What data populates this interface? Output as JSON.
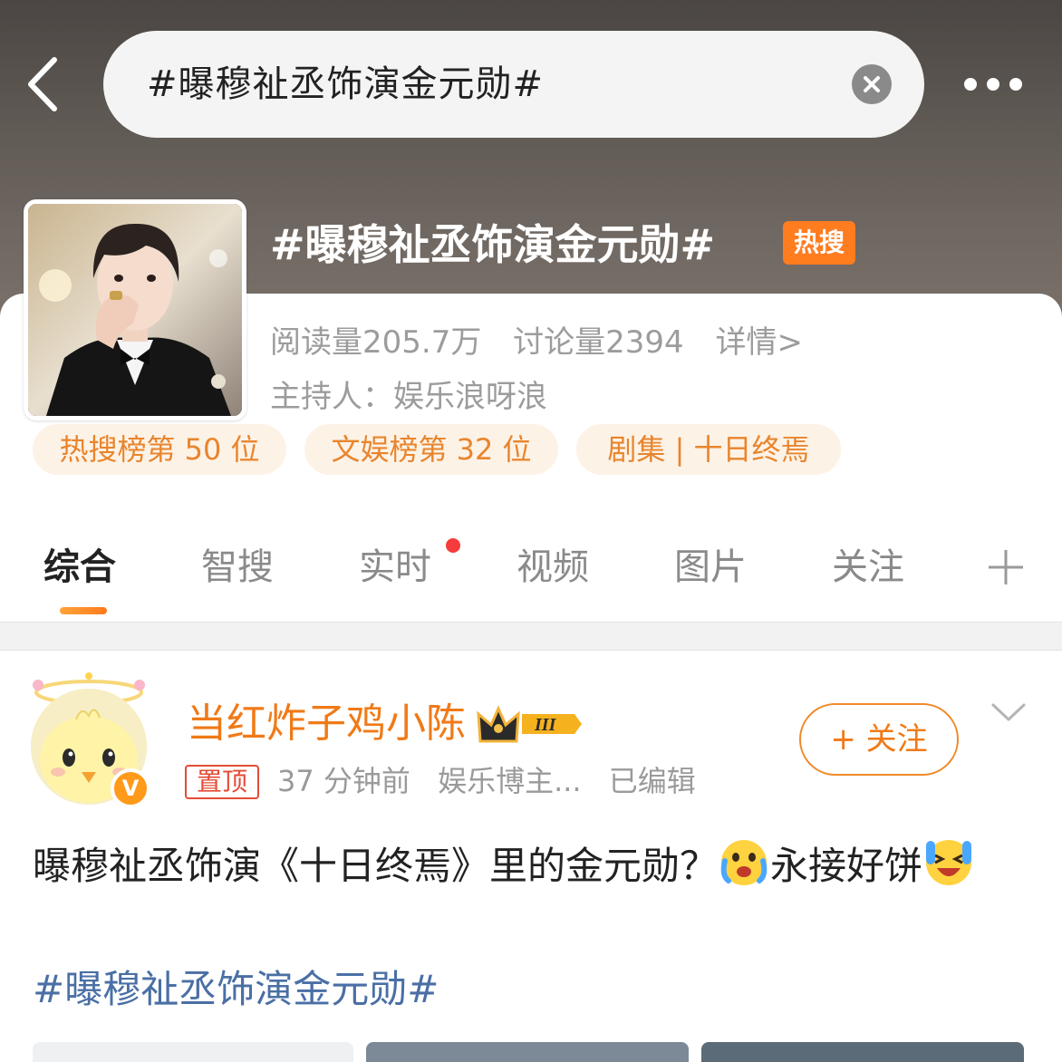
{
  "search": {
    "query": "#曝穆祉丞饰演金元勋#"
  },
  "topic": {
    "title": "#曝穆祉丞饰演金元勋#",
    "hot_badge": "热搜",
    "reads": "阅读量205.7万",
    "discussions": "讨论量2394",
    "details_link": "详情>",
    "host": "主持人：娱乐浪呀浪",
    "chips": [
      "热搜榜第 50 位",
      "文娱榜第 32 位",
      "剧集 | 十日终焉"
    ]
  },
  "tabs": [
    {
      "label": "综合",
      "active": true
    },
    {
      "label": "智搜"
    },
    {
      "label": "实时",
      "has_dot": true
    },
    {
      "label": "视频"
    },
    {
      "label": "图片"
    },
    {
      "label": "关注"
    }
  ],
  "post": {
    "username": "当红炸子鸡小陈",
    "level_badge": "III",
    "pinned_tag": "置顶",
    "time": "37 分钟前",
    "source": "娱乐博主...",
    "edited": "已编辑",
    "follow_label": "+ 关注",
    "verified_mark": "V",
    "text_part1": "曝穆祉丞饰演《十日终焉》里的金元勋？",
    "text_part2": "永接好饼",
    "hashtag": "#曝穆祉丞饰演金元勋#"
  },
  "colors": {
    "accent_orange": "#f07a17",
    "hot_badge": "#ff7c1f",
    "chip_bg": "#fdf2e6",
    "chip_text": "#e8852d",
    "hashtag_blue": "#4a6fa5",
    "notification_red": "#f53b3b"
  },
  "icons": {
    "back": "chevron-left-icon",
    "clear": "close-circle-icon",
    "more": "more-dots-icon",
    "add_tab": "plus-icon",
    "crown": "crown-icon",
    "collapse": "chevron-down-icon"
  }
}
